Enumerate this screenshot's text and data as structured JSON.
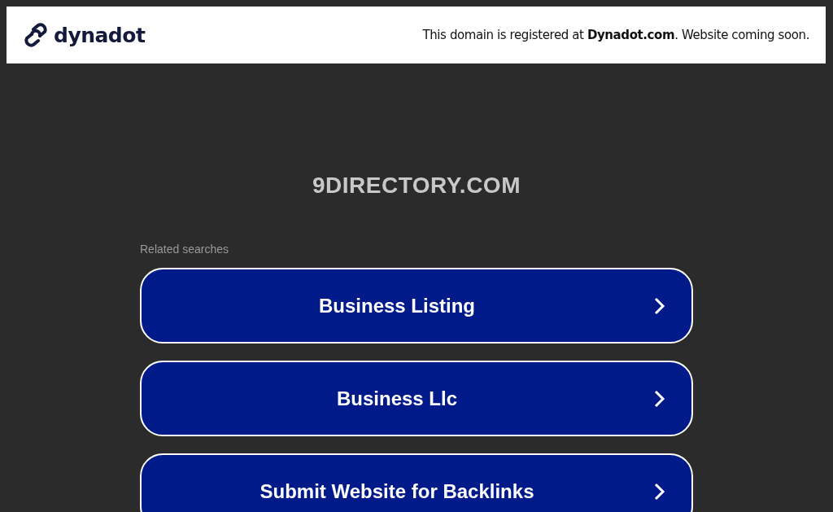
{
  "header": {
    "logo_text": "dynadot",
    "notice": "This domain is registered at **Dynadot.com**. Website coming soon."
  },
  "domain": "9DIRECTORY.COM",
  "related": {
    "label": "Related searches",
    "items": [
      {
        "label": "Business Listing"
      },
      {
        "label": "Business Llc"
      },
      {
        "label": "Submit Website for Backlinks"
      }
    ]
  }
}
